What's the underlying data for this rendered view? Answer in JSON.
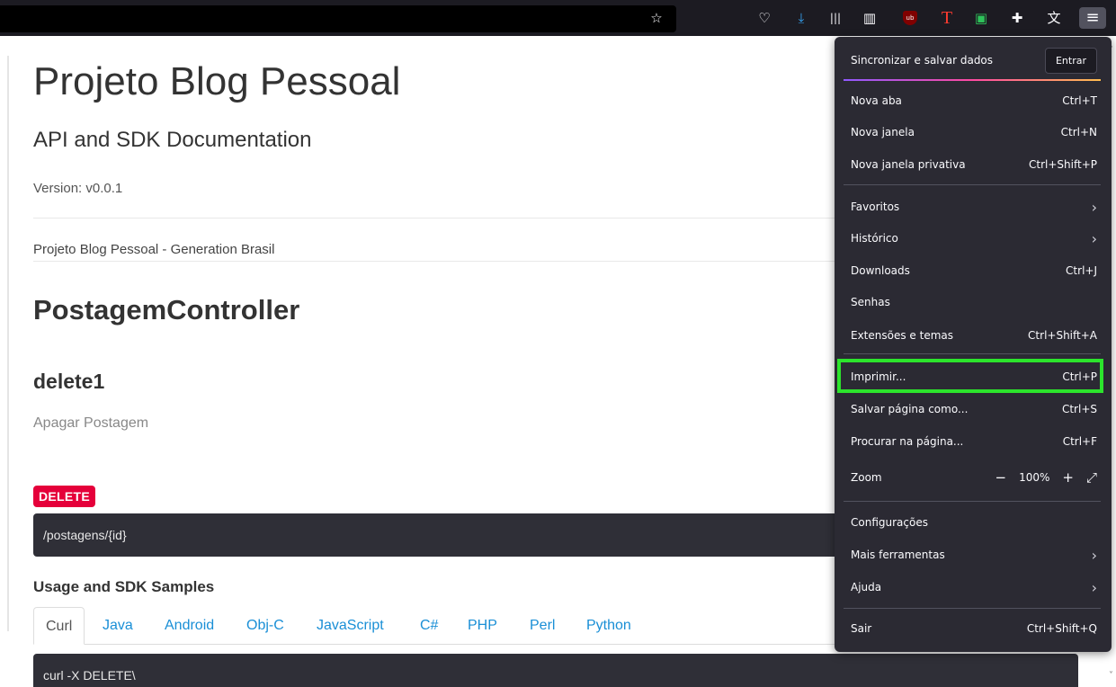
{
  "browser": {
    "menu": {
      "sync": {
        "label": "Sincronizar e salvar dados",
        "button": "Entrar"
      },
      "items": [
        {
          "label": "Nova aba",
          "shortcut": "Ctrl+T"
        },
        {
          "label": "Nova janela",
          "shortcut": "Ctrl+N"
        },
        {
          "label": "Nova janela privativa",
          "shortcut": "Ctrl+Shift+P"
        },
        {
          "label": "Favoritos",
          "shortcut": ""
        },
        {
          "label": "Histórico",
          "shortcut": ""
        },
        {
          "label": "Downloads",
          "shortcut": "Ctrl+J"
        },
        {
          "label": "Senhas",
          "shortcut": ""
        },
        {
          "label": "Extensões e temas",
          "shortcut": "Ctrl+Shift+A"
        },
        {
          "label": "Imprimir...",
          "shortcut": "Ctrl+P"
        },
        {
          "label": "Salvar página como...",
          "shortcut": "Ctrl+S"
        },
        {
          "label": "Procurar na página...",
          "shortcut": "Ctrl+F"
        },
        {
          "label": "Zoom",
          "shortcut": ""
        },
        {
          "label": "Configurações",
          "shortcut": ""
        },
        {
          "label": "Mais ferramentas",
          "shortcut": ""
        },
        {
          "label": "Ajuda",
          "shortcut": ""
        },
        {
          "label": "Sair",
          "shortcut": "Ctrl+Shift+Q"
        }
      ],
      "zoom": {
        "minus": "−",
        "value": "100%",
        "plus": "+",
        "fullscreen": "⤢"
      },
      "chevron": "›"
    },
    "toolbar_icons": {
      "star": "☆",
      "pocket": "♡",
      "download": "⤓",
      "library": "|||",
      "sidebar": "▥",
      "ublock": "ub",
      "t_ext": "T",
      "green_ext": "▣",
      "puzzle": "✚",
      "translate": "文",
      "hamburger": "≡"
    },
    "accent_colors": {
      "highlight": "#2ce42c",
      "badge": "#e5003a",
      "link": "#1a8fd6"
    }
  },
  "page": {
    "title": "Projeto Blog Pessoal",
    "subtitle": "API and SDK Documentation",
    "version": "Version: v0.0.1",
    "description": "Projeto Blog Pessoal - Generation Brasil",
    "controller": "PostagemController",
    "method": {
      "name": "delete1",
      "description": "Apagar Postagem",
      "verb": "DELETE",
      "path": "/postagens/{id}"
    },
    "samples_heading": "Usage and SDK Samples",
    "tabs": [
      "Curl",
      "Java",
      "Android",
      "Obj-C",
      "JavaScript",
      "C#",
      "PHP",
      "Perl",
      "Python"
    ],
    "code": "curl -X DELETE\\"
  }
}
